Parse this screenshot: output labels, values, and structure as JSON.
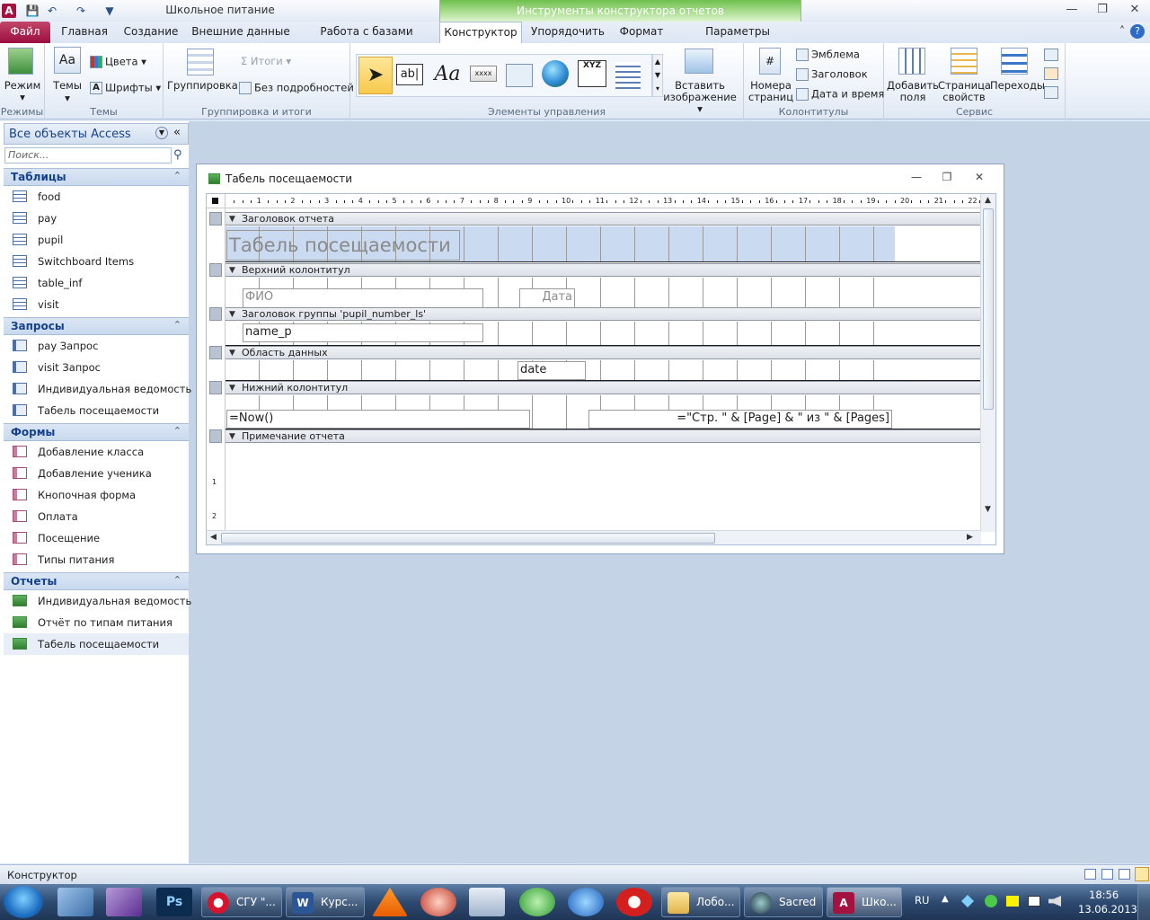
{
  "app": {
    "title": "Школьное питание",
    "context_tab_group": "Инструменты конструктора отчетов"
  },
  "tabs": [
    {
      "label": "Файл"
    },
    {
      "label": "Главная"
    },
    {
      "label": "Создание"
    },
    {
      "label": "Внешние данные"
    },
    {
      "label": "Работа с базами данных"
    },
    {
      "label": "Конструктор"
    },
    {
      "label": "Упорядочить"
    },
    {
      "label": "Формат"
    },
    {
      "label": "Параметры страницы"
    }
  ],
  "ribbon": {
    "modes": {
      "button": "Режим",
      "group": "Режимы"
    },
    "themes": {
      "themes": "Темы",
      "colors": "Цвета",
      "fonts": "Шрифты",
      "group": "Темы"
    },
    "grouping": {
      "group_btn": "Группировка",
      "totals": "Итоги",
      "no_details": "Без подробностей",
      "group": "Группировка и итоги"
    },
    "controls": {
      "group": "Элементы управления",
      "insert_image": "Вставить изображение"
    },
    "header_footer": {
      "logo": "Эмблема",
      "title": "Заголовок",
      "date_time": "Дата и время",
      "page_numbers": "Номера страниц",
      "group": "Колонтитулы"
    },
    "tools": {
      "add_fields": "Добавить поля",
      "property_sheet": "Страница свойств",
      "tab_order": "Переходы",
      "group": "Сервис"
    }
  },
  "nav": {
    "header": "Все объекты Access",
    "search_placeholder": "Поиск...",
    "sections": [
      {
        "label": "Таблицы",
        "type": "table",
        "items": [
          "food",
          "pay",
          "pupil",
          "Switchboard Items",
          "table_inf",
          "visit"
        ]
      },
      {
        "label": "Запросы",
        "type": "query",
        "items": [
          "pay Запрос",
          "visit Запрос",
          "Индивидуальная ведомость",
          "Табель посещаемости"
        ]
      },
      {
        "label": "Формы",
        "type": "form",
        "items": [
          "Добавление класса",
          "Добавление ученика",
          "Кнопочная форма",
          "Оплата",
          "Посещение",
          "Типы питания"
        ]
      },
      {
        "label": "Отчеты",
        "type": "report",
        "items": [
          "Индивидуальная ведомость",
          "Отчёт по типам питания",
          "Табель посещаемости"
        ],
        "selected": 2
      }
    ]
  },
  "document": {
    "title": "Табель посещаемости",
    "ruler_numbers": [
      "1",
      "2",
      "3",
      "4",
      "5",
      "6",
      "7",
      "8",
      "9",
      "10",
      "11",
      "12",
      "13",
      "14",
      "15",
      "16",
      "17",
      "18",
      "19",
      "20",
      "21",
      "22"
    ],
    "vruler_numbers": [
      "1",
      "2"
    ],
    "bands": {
      "report_header": "Заголовок отчета",
      "page_header": "Верхний колонтитул",
      "group_header": "Заголовок группы 'pupil_number_ls'",
      "detail": "Область данных",
      "page_footer": "Нижний колонтитул",
      "report_footer": "Примечание отчета"
    },
    "controls": {
      "report_title": "Табель посещаемости",
      "lbl_fio": "ФИО",
      "lbl_date": "Дата",
      "fld_name": "name_p",
      "fld_date": "date",
      "fld_now": "=Now()",
      "fld_pages": "=\"Стр. \" & [Page] & \" из \" & [Pages]"
    }
  },
  "status": {
    "mode": "Конструктор"
  },
  "taskbar": {
    "buttons": [
      "СГУ \"...",
      "Курс...",
      "Лобо...",
      "Sacred",
      "Шко..."
    ],
    "lang": "RU",
    "time": "18:56",
    "date": "13.06.2013"
  }
}
